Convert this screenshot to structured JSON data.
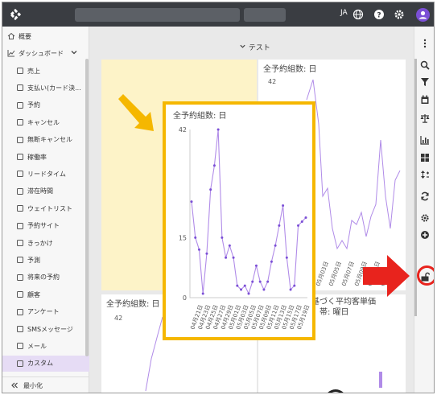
{
  "header": {
    "lang": "JA"
  },
  "sidebar": {
    "overview": "概要",
    "dashboard": "ダッシュボード",
    "items": [
      "売上",
      "支払い(カード決...",
      "予約",
      "キャンセル",
      "無断キャンセル",
      "稼働率",
      "リードタイム",
      "滞在時間",
      "ウェイトリスト",
      "予約サイト",
      "きっかけ",
      "予測",
      "将来の予約",
      "顧客",
      "アンケート",
      "SMSメッセージ",
      "メール",
      "カスタム"
    ],
    "minimize": "最小化"
  },
  "main": {
    "section_title": "テスト",
    "card_top_right_title": "全予約組数: 日",
    "card_top_right_ytop": "42",
    "card_bottom_left_title": "全予約組数: 日",
    "card_bottom_left_ytop": "42",
    "card_bottom_right_title_1": "に基づく平均客単価",
    "card_bottom_right_title_2": "帯: 曜日",
    "x_ticks_partial": [
      "05月01日",
      "05月03日",
      "05月05日",
      "05月07日",
      "05月09日",
      "05月11日",
      "05月13日"
    ]
  },
  "focus_card": {
    "title": "全予約組数: 日"
  },
  "colors": {
    "accent": "#7b4fd6",
    "line": "#b08be8",
    "highlight_yellow": "#f5b700",
    "highlight_red": "#e8231d"
  },
  "chart_data": {
    "type": "line",
    "title": "全予約組数: 日",
    "ylim": [
      0,
      42
    ],
    "y_ticks": [
      0,
      15,
      42
    ],
    "x_ticks": [
      "04月21日",
      "04月23日",
      "04月25日",
      "04月27日",
      "04月29日",
      "05月01日",
      "05月03日",
      "05月05日",
      "05月07日",
      "05月09日",
      "05月11日",
      "05月13日",
      "05月15日",
      "05月17日",
      "05月19日"
    ],
    "values": [
      24,
      15,
      12,
      1,
      11,
      27,
      33,
      42,
      15,
      10,
      13,
      10,
      3,
      2,
      3,
      1,
      4,
      8,
      4,
      2,
      4,
      9,
      13,
      18,
      23,
      10,
      2,
      3,
      18,
      19,
      20
    ]
  }
}
